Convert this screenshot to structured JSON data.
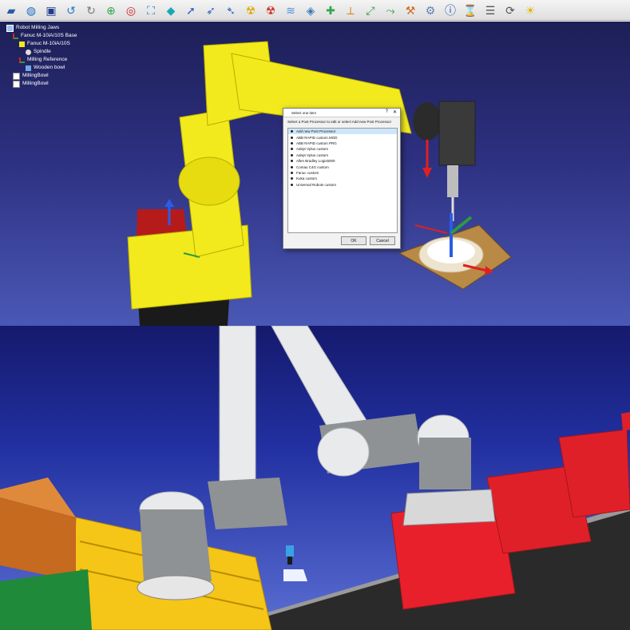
{
  "toolbar": {
    "icons": [
      "open-icon",
      "globe-icon",
      "save-icon",
      "undo-icon",
      "redo-icon",
      "add-reference-frame-icon",
      "add-target-icon",
      "fit-all-icon",
      "view-3d-icon",
      "select-icon",
      "select-move-icon",
      "select-rotate-icon",
      "radiation-icon",
      "radiation-icon",
      "teach-icon",
      "python-icon",
      "add-program-icon",
      "move-joint-icon",
      "move-linear-icon",
      "move-circular-icon",
      "add-tool-icon",
      "settings-icon",
      "info-icon",
      "wait-icon",
      "program-icon",
      "sync-icon",
      "help-icon"
    ]
  },
  "tree": {
    "items": [
      {
        "label": "Robot Milling Jaws",
        "level": 0,
        "icon": "station-icon"
      },
      {
        "label": "Fanuc M-10iA/10S Base",
        "level": 1,
        "icon": "frame-icon"
      },
      {
        "label": "Fanuc M-10iA/10S",
        "level": 2,
        "icon": "robot-icon"
      },
      {
        "label": "Spindle",
        "level": 3,
        "icon": "tool-icon"
      },
      {
        "label": "Milling Reference",
        "level": 2,
        "icon": "frame-icon"
      },
      {
        "label": "Wooden bowl",
        "level": 3,
        "icon": "object-icon"
      },
      {
        "label": "MillingBowl",
        "level": 1,
        "icon": "program-icon"
      },
      {
        "label": "MillingBowl",
        "level": 1,
        "icon": "program-icon"
      }
    ]
  },
  "dialog": {
    "title": "Select one item",
    "prompt": "Select a Post Processor to edit or select Add new Post Processor",
    "options": [
      "Add new Post Processor",
      "ABB RAPID custom MOD",
      "ABB RAPID custom PRG",
      "Adept Vplus custom",
      "Adept Vplus custom",
      "Allen Bradley Logix5000",
      "Comau C4G custom",
      "Fanuc custom",
      "Kuka custom",
      "Universal Robots custom"
    ],
    "selected_index": 0,
    "ok_label": "OK",
    "cancel_label": "Cancel"
  },
  "colors": {
    "robot_yellow": "#f2ea1c",
    "cube_red": "#e8202b",
    "ur_gray": "#8f9294",
    "toolbar_bg": "#e8e8e8"
  }
}
